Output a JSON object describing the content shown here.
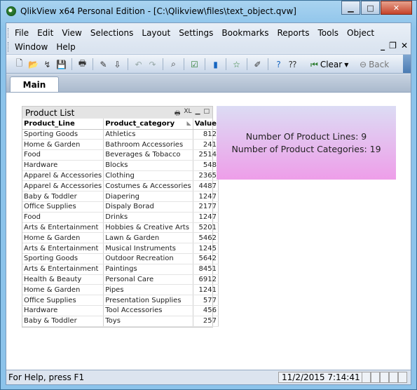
{
  "window": {
    "title": "QlikView x64 Personal Edition - [C:\\Qlikview\\files\\text_object.qvw]",
    "minimize": "▁",
    "maximize": "□",
    "close": "✕"
  },
  "menu": {
    "row1": [
      "File",
      "Edit",
      "View",
      "Selections",
      "Layout",
      "Settings",
      "Bookmarks",
      "Reports",
      "Tools",
      "Object"
    ],
    "row2": [
      "Window",
      "Help"
    ]
  },
  "toolbar": {
    "clear_label": "Clear",
    "back_label": "Back"
  },
  "tabs": [
    {
      "label": "Main"
    }
  ],
  "table_box": {
    "title": "Product List",
    "xl_label": "XL",
    "columns": [
      "Product_Line",
      "Product_category",
      "Value"
    ],
    "rows": [
      [
        "Sporting Goods",
        "Athletics",
        "812"
      ],
      [
        "Home & Garden",
        "Bathroom Accessories",
        "241"
      ],
      [
        "Food",
        "Beverages & Tobacco",
        "2514"
      ],
      [
        "Hardware",
        "Blocks",
        "548"
      ],
      [
        "Apparel & Accessories",
        "Clothing",
        "2365"
      ],
      [
        "Apparel & Accessories",
        "Costumes & Accessories",
        "4487"
      ],
      [
        "Baby & Toddler",
        "Diapering",
        "1247"
      ],
      [
        "Office Supplies",
        "Dispaly Borad",
        "2177"
      ],
      [
        "Food",
        "Drinks",
        "1247"
      ],
      [
        "Arts & Entertainment",
        "Hobbies & Creative Arts",
        "5201"
      ],
      [
        "Home & Garden",
        "Lawn & Garden",
        "5462"
      ],
      [
        "Arts & Entertainment",
        "Musical Instruments",
        "1245"
      ],
      [
        "Sporting Goods",
        "Outdoor Recreation",
        "5642"
      ],
      [
        "Arts & Entertainment",
        "Paintings",
        "8451"
      ],
      [
        "Health & Beauty",
        "Personal Care",
        "6912"
      ],
      [
        "Home & Garden",
        "Pipes",
        "1241"
      ],
      [
        "Office Supplies",
        "Presentation Supplies",
        "577"
      ],
      [
        "Hardware",
        "Tool Accessories",
        "456"
      ],
      [
        "Baby & Toddler",
        "Toys",
        "257"
      ]
    ]
  },
  "text_object": {
    "line1": "Number Of Product Lines: 9",
    "line2": "Number of Product Categories: 19"
  },
  "status": {
    "help_text": "For Help, press F1",
    "datetime": "11/2/2015 7:14:41 AM"
  },
  "colors": {
    "text_object_top": "#dcdcf4",
    "text_object_bottom": "#ee9ee9"
  }
}
